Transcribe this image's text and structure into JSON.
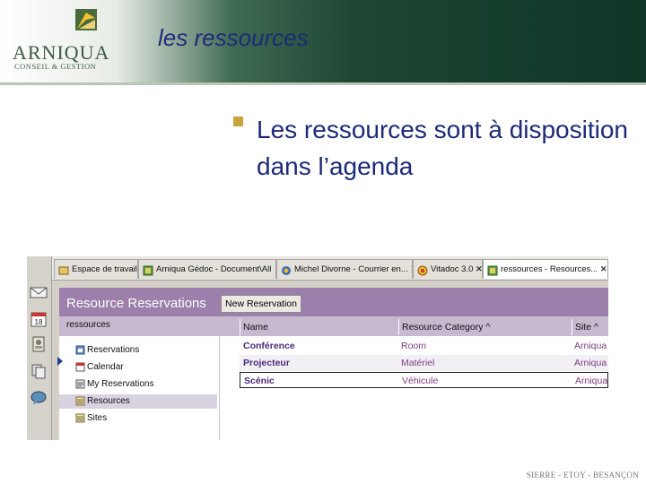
{
  "slide": {
    "title": "les ressources",
    "bullet": "Les ressources sont à disposition dans l’agenda",
    "footer": "SIERRE - ETOY - BESANÇON",
    "logo": {
      "name": "ARNIQUA",
      "subtitle": "CONSEIL & GESTION"
    }
  },
  "colors": {
    "title_blue": "#1d2a78",
    "bullet_gold": "#c9a23c",
    "header_purple": "#9c7fab",
    "item_purple": "#4b2a7a"
  },
  "sidebar": {
    "icons": [
      "mail-icon",
      "calendar-icon",
      "contacts-icon",
      "replicator-icon",
      "chat-icon"
    ]
  },
  "tabs": [
    {
      "label": "Espace de travail",
      "icon": "workspace-icon",
      "closable": false,
      "active": false
    },
    {
      "label": "Arniqua Gédoc - Document\\All",
      "icon": "database-icon",
      "closable": false,
      "active": false
    },
    {
      "label": "Michel Divorne - Courrier en...",
      "icon": "mail-icon",
      "closable": true,
      "active": false
    },
    {
      "label": "Vitadoc 3.0",
      "icon": "app-icon",
      "closable": true,
      "active": false
    },
    {
      "label": "ressources - Resources...",
      "icon": "database-icon",
      "closable": true,
      "active": true
    }
  ],
  "app": {
    "title": "Resource Reservations",
    "new_button": "New Reservation",
    "tree_title": "ressources",
    "tree": [
      {
        "label": "Reservations",
        "icon": "reservations-icon",
        "selected": false
      },
      {
        "label": "Calendar",
        "icon": "calendar-icon",
        "selected": false
      },
      {
        "label": "My Reservations",
        "icon": "my-reservations-icon",
        "selected": false
      },
      {
        "label": "Resources",
        "icon": "resources-icon",
        "selected": true
      },
      {
        "label": "Sites",
        "icon": "sites-icon",
        "selected": false
      }
    ],
    "columns": [
      "Name",
      "Resource Category ^",
      "Site ^"
    ],
    "rows": [
      {
        "name": "Conférence",
        "category": "Room",
        "site": "Arniqua"
      },
      {
        "name": "Projecteur",
        "category": "Matériel",
        "site": "Arniqua"
      },
      {
        "name": "Scénic",
        "category": "Véhicule",
        "site": "Arniqua"
      }
    ]
  }
}
